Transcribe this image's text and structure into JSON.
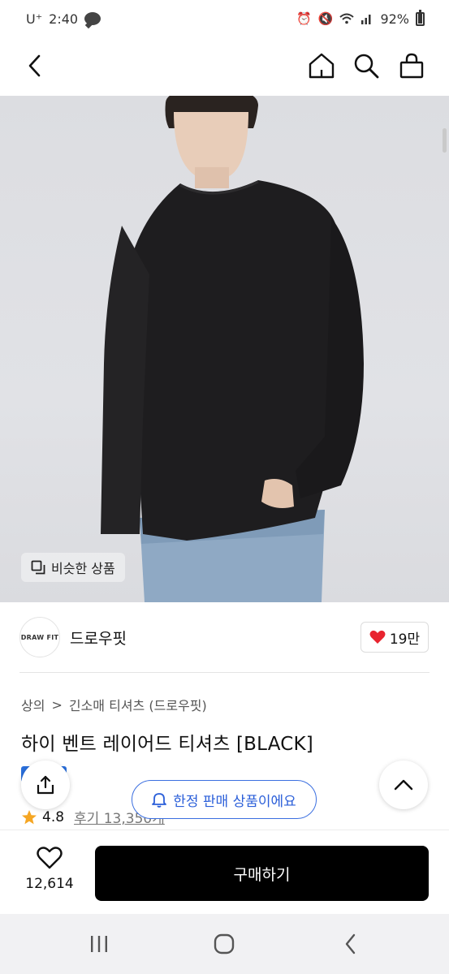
{
  "status_bar": {
    "carrier": "U⁺",
    "time": "2:40",
    "battery": "92%"
  },
  "similar_button": {
    "label": "비슷한 상품"
  },
  "brand": {
    "logo_text": "DRAW FIT",
    "name": "드로우핏",
    "likes": "19만"
  },
  "breadcrumb": {
    "level1": "상의",
    "separator": ">",
    "level2": "긴소매 티셔츠 (드로우핏)"
  },
  "product": {
    "title": "하이 벤트 레이어드 티셔츠 [BLACK]",
    "rating": "4.8",
    "reviews": "후기 13,350개"
  },
  "limited_banner": {
    "label": "한정 판매 상품이에요"
  },
  "purchase": {
    "wish_count": "12,614",
    "buy_label": "구매하기"
  },
  "colors": {
    "buy_button": "#000000",
    "accent_blue": "#2b5fd9",
    "heart_red": "#e8242f",
    "star": "#f5a623"
  },
  "icons": [
    "back-icon",
    "home-icon",
    "search-icon",
    "shopping-bag-icon",
    "copy-icon",
    "heart-icon",
    "share-icon",
    "chevron-up-icon",
    "bell-icon",
    "star-icon",
    "recent-apps-icon",
    "home-circle-icon",
    "system-back-icon"
  ]
}
